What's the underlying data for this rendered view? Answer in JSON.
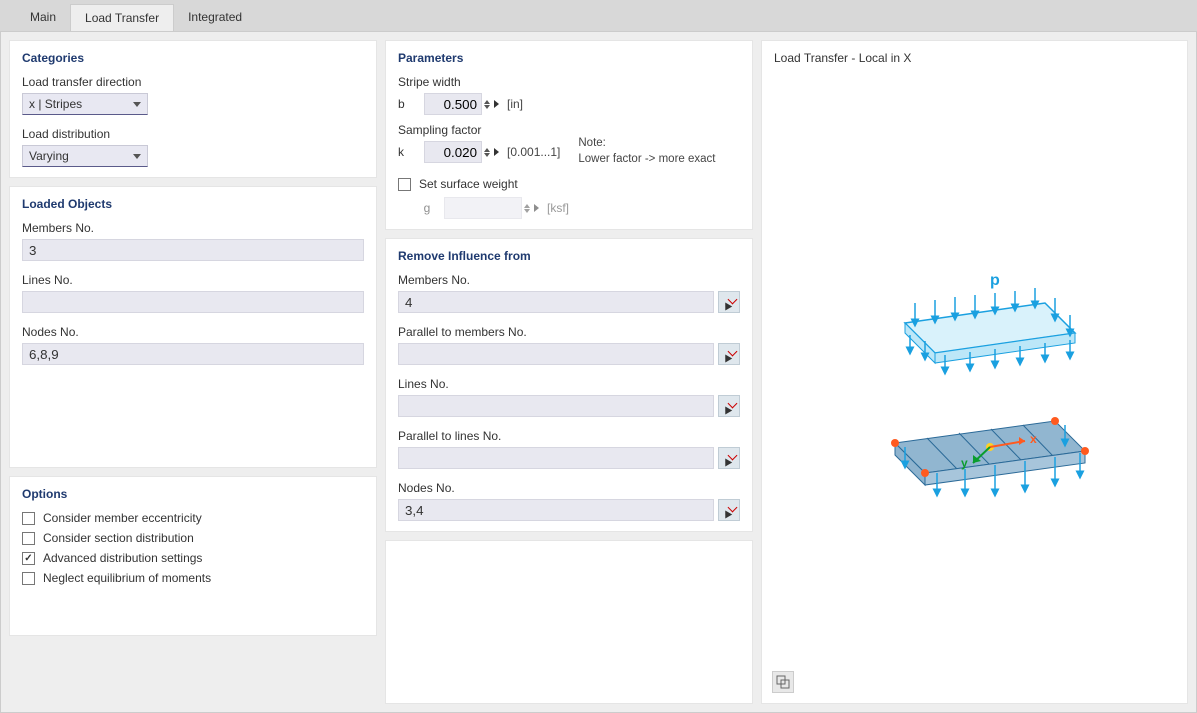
{
  "tabs": {
    "main": "Main",
    "load_transfer": "Load Transfer",
    "integrated": "Integrated"
  },
  "categories": {
    "title": "Categories",
    "direction_label": "Load transfer direction",
    "direction_value": "x | Stripes",
    "distribution_label": "Load distribution",
    "distribution_value": "Varying"
  },
  "parameters": {
    "title": "Parameters",
    "stripe_width_label": "Stripe width",
    "b_sym": "b",
    "b_value": "0.500",
    "b_unit": "[in]",
    "sampling_factor_label": "Sampling factor",
    "k_sym": "k",
    "k_value": "0.020",
    "k_unit": "[0.001...1]",
    "note_label": "Note:",
    "note_text": "Lower factor ->  more exact",
    "set_surface_weight_label": "Set surface weight",
    "g_sym": "g",
    "g_value": "",
    "g_unit": "[ksf]"
  },
  "loaded_objects": {
    "title": "Loaded Objects",
    "members_label": "Members No.",
    "members_value": "3",
    "lines_label": "Lines No.",
    "lines_value": "",
    "nodes_label": "Nodes No.",
    "nodes_value": "6,8,9"
  },
  "remove_influence": {
    "title": "Remove Influence from",
    "members_label": "Members No.",
    "members_value": "4",
    "parallel_members_label": "Parallel to members No.",
    "parallel_members_value": "",
    "lines_label": "Lines No.",
    "lines_value": "",
    "parallel_lines_label": "Parallel to lines No.",
    "parallel_lines_value": "",
    "nodes_label": "Nodes No.",
    "nodes_value": "3,4"
  },
  "options": {
    "title": "Options",
    "opt1": "Consider member eccentricity",
    "opt2": "Consider section distribution",
    "opt3": "Advanced distribution settings",
    "opt4": "Neglect equilibrium of moments"
  },
  "preview": {
    "title": "Load Transfer - Local in X",
    "label_p": "p",
    "axis_x": "x",
    "axis_y": "y"
  }
}
